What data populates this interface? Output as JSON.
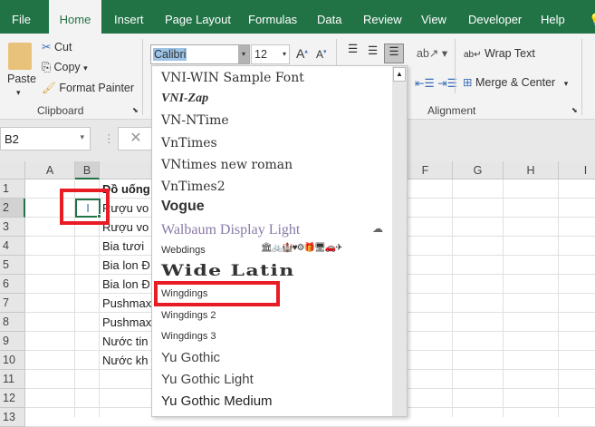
{
  "tabs": [
    "File",
    "Home",
    "Insert",
    "Page Layout",
    "Formulas",
    "Data",
    "Review",
    "View",
    "Developer",
    "Help"
  ],
  "clipboard": {
    "paste": "Paste",
    "cut": "Cut",
    "copy": "Copy",
    "format_painter": "Format Painter",
    "group": "Clipboard"
  },
  "font": {
    "name": "Calibri",
    "size": "12"
  },
  "alignment": {
    "wrap": "Wrap Text",
    "merge": "Merge & Center",
    "group": "Alignment"
  },
  "name_box": "B2",
  "columns": [
    "A",
    "B",
    "",
    "",
    "",
    "F",
    "G",
    "H",
    "I"
  ],
  "rows": [
    "1",
    "2",
    "3",
    "4",
    "5",
    "6",
    "7",
    "8",
    "9",
    "10",
    "11",
    "12",
    "13"
  ],
  "cells": {
    "b2": "I",
    "c": [
      "Đồ uống",
      "Rượu vo",
      "Rượu vo",
      "Bia tươi",
      "Bia lon Đ",
      "Bia lon Đ",
      "Pushmax",
      "Pushmax",
      "Nước tin",
      "Nước kh"
    ]
  },
  "font_list": [
    "VNI-WIN Sample Font",
    "VNI-Zap",
    "VN-NTime",
    "VnTimes",
    "VNtimes new roman",
    "VnTimes2",
    "Vogue",
    "Walbaum Display Light",
    "Webdings",
    "Wide Latin",
    "Wingdings",
    "Wingdings 2",
    "Wingdings 3",
    "Yu Gothic",
    "Yu Gothic Light",
    "Yu Gothic Medium"
  ],
  "webdings_preview": "🏛🚲🏰♥⚙🎁🖥🚗✈",
  "accent": "#217346"
}
